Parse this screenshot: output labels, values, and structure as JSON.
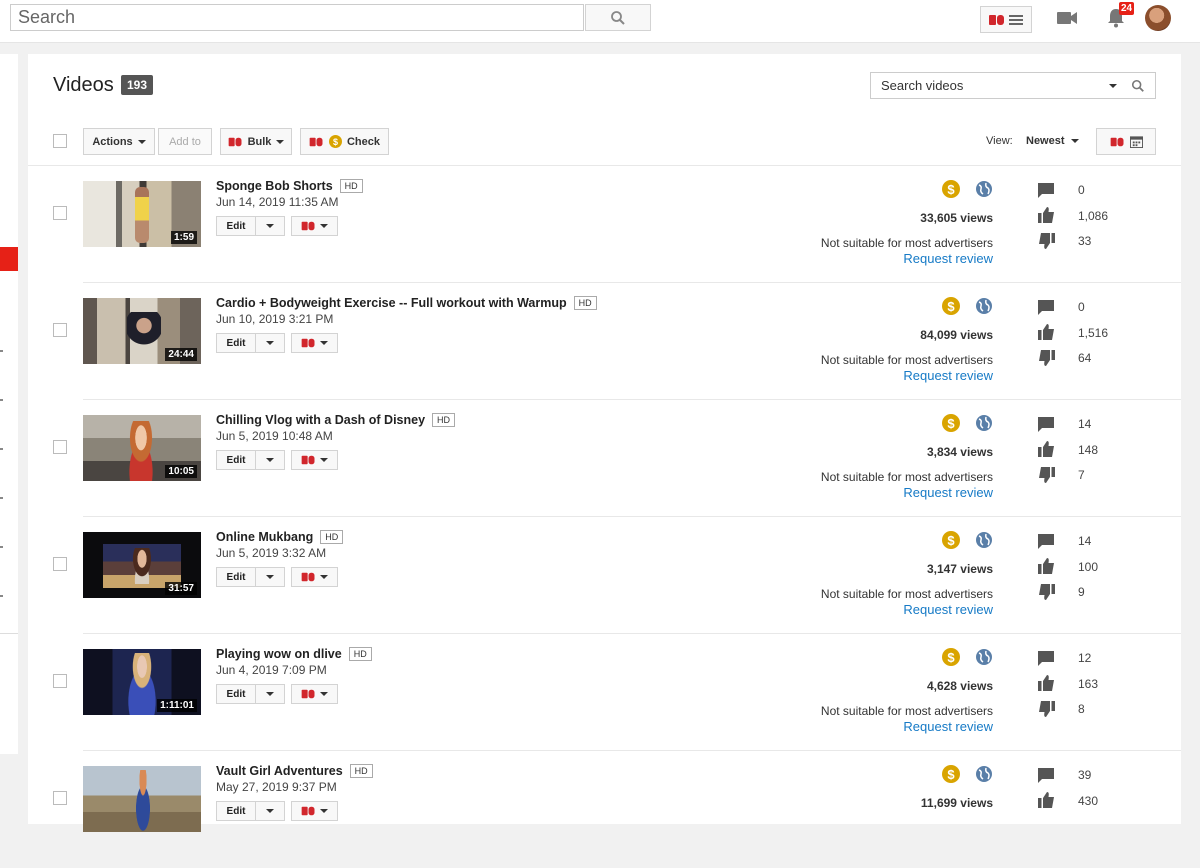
{
  "topbar": {
    "search_placeholder": "Search",
    "notification_count": "24"
  },
  "header": {
    "title": "Videos",
    "count": "193",
    "search_videos_placeholder": "Search videos"
  },
  "toolbar": {
    "actions_label": "Actions",
    "add_to_label": "Add to",
    "bulk_label": "Bulk",
    "check_label": "Check",
    "view_label": "View:",
    "sort_label": "Newest"
  },
  "row_labels": {
    "edit": "Edit",
    "hd": "HD",
    "not_suitable": "Not suitable for most advertisers",
    "request_review": "Request review"
  },
  "colors": {
    "accent_red": "#e62117",
    "link_blue": "#167ac6",
    "monetization_gold": "#d9a400"
  },
  "videos": [
    {
      "title": "Sponge Bob Shorts",
      "date": "Jun 14, 2019 11:35 AM",
      "duration": "1:59",
      "views": "33,605 views",
      "comments": "0",
      "likes": "1,086",
      "dislikes": "33"
    },
    {
      "title": "Cardio + Bodyweight Exercise -- Full workout with Warmup",
      "date": "Jun 10, 2019 3:21 PM",
      "duration": "24:44",
      "views": "84,099 views",
      "comments": "0",
      "likes": "1,516",
      "dislikes": "64"
    },
    {
      "title": "Chilling Vlog with a Dash of Disney",
      "date": "Jun 5, 2019 10:48 AM",
      "duration": "10:05",
      "views": "3,834 views",
      "comments": "14",
      "likes": "148",
      "dislikes": "7"
    },
    {
      "title": "Online Mukbang",
      "date": "Jun 5, 2019 3:32 AM",
      "duration": "31:57",
      "views": "3,147 views",
      "comments": "14",
      "likes": "100",
      "dislikes": "9"
    },
    {
      "title": "Playing wow on dlive",
      "date": "Jun 4, 2019 7:09 PM",
      "duration": "1:11:01",
      "views": "4,628 views",
      "comments": "12",
      "likes": "163",
      "dislikes": "8"
    },
    {
      "title": "Vault Girl Adventures",
      "date": "May 27, 2019 9:37 PM",
      "duration": "",
      "views": "11,699 views",
      "comments": "39",
      "likes": "430",
      "dislikes": ""
    }
  ]
}
